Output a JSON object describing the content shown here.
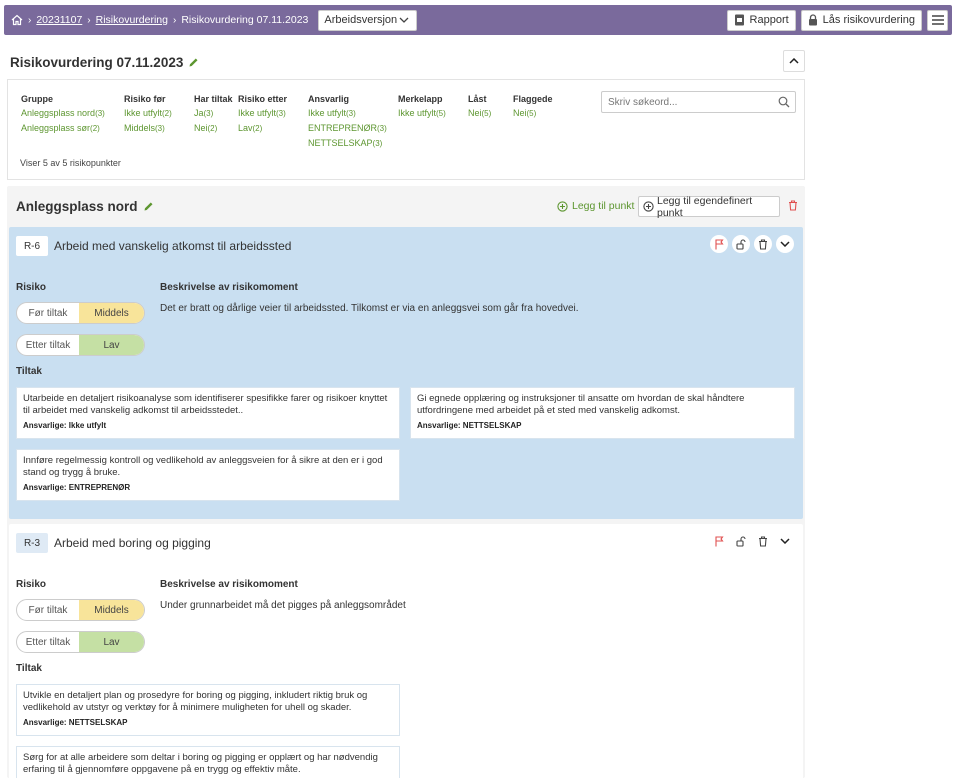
{
  "breadcrumb": {
    "project": "20231107",
    "section": "Risikovurdering",
    "current": "Risikovurdering 07.11.2023"
  },
  "version_select": {
    "value": "Arbeidsversjon"
  },
  "toolbar": {
    "report_label": "Rapport",
    "lock_label": "Lås risikovurdering"
  },
  "page": {
    "title": "Risikovurdering 07.11.2023"
  },
  "filters": {
    "columns": [
      {
        "header": "Gruppe",
        "items": [
          {
            "label": "Anleggsplass nord",
            "count": "(3)"
          },
          {
            "label": "Anleggsplass sør",
            "count": "(2)"
          }
        ]
      },
      {
        "header": "Risiko før",
        "items": [
          {
            "label": "Ikke utfylt",
            "count": "(2)"
          },
          {
            "label": "Middels",
            "count": "(3)"
          }
        ]
      },
      {
        "header": "Har tiltak",
        "items": [
          {
            "label": "Ja",
            "count": "(3)"
          },
          {
            "label": "Nei",
            "count": "(2)"
          }
        ]
      },
      {
        "header": "Risiko etter",
        "items": [
          {
            "label": "Ikke utfylt",
            "count": "(3)"
          },
          {
            "label": "Lav",
            "count": "(2)"
          }
        ]
      },
      {
        "header": "Ansvarlig",
        "items": [
          {
            "label": "Ikke utfylt",
            "count": "(3)"
          },
          {
            "label": "ENTREPRENØR",
            "count": "(3)"
          },
          {
            "label": "NETTSELSKAP",
            "count": "(3)"
          }
        ]
      },
      {
        "header": "Merkelapp",
        "items": [
          {
            "label": "Ikke utfylt",
            "count": "(5)"
          }
        ]
      },
      {
        "header": "Låst",
        "items": [
          {
            "label": "Nei",
            "count": "(5)"
          }
        ]
      },
      {
        "header": "Flaggede",
        "items": [
          {
            "label": "Nei",
            "count": "(5)"
          }
        ]
      }
    ],
    "search_placeholder": "Skriv søkeord...",
    "summary": "Viser 5 av 5 risikopunkter"
  },
  "group": {
    "title": "Anleggsplass nord",
    "add_point_label": "Legg til punkt",
    "add_custom_label": "Legg til egendefinert punkt"
  },
  "labels": {
    "risk": "Risiko",
    "description_heading": "Beskrivelse av risikomoment",
    "measures": "Tiltak",
    "before": "Før tiltak",
    "after": "Etter tiltak"
  },
  "cards": [
    {
      "id": "R-6",
      "title": "Arbeid med vanskelig atkomst til arbeidssted",
      "risk_before": "Middels",
      "risk_after": "Lav",
      "description": "Det er bratt og dårlige veier til arbeidssted. Tilkomst er via en anleggsvei som går fra hovedvei.",
      "measures": [
        {
          "text": "Utarbeide en detaljert risikoanalyse som identifiserer spesifikke farer og risikoer knyttet til arbeidet med vanskelig adkomst til arbeidsstedet..",
          "responsible": "Ansvarlige: Ikke utfylt"
        },
        {
          "text": "Gi egnede opplæring og instruksjoner til ansatte om hvordan de skal håndtere utfordringene med arbeidet på et sted med vanskelig adkomst.",
          "responsible": "Ansvarlige: NETTSELSKAP"
        },
        {
          "text": "Innføre regelmessig kontroll og vedlikehold av anleggsveien for å sikre at den er i god stand og trygg å bruke.",
          "responsible": "Ansvarlige: ENTREPRENØR"
        }
      ]
    },
    {
      "id": "R-3",
      "title": "Arbeid med boring og pigging",
      "risk_before": "Middels",
      "risk_after": "Lav",
      "description": "Under grunnarbeidet må det pigges på anleggsområdet",
      "measures": [
        {
          "text": "Utvikle en detaljert plan og prosedyre for boring og pigging, inkludert riktig bruk og vedlikehold av utstyr og verktøy for å minimere muligheten for uhell og skader.",
          "responsible": "Ansvarlige: NETTSELSKAP"
        },
        {
          "text": "Sørg for at alle arbeidere som deltar i boring og pigging er opplært og har nødvendig erfaring til å gjennomføre oppgavene på en trygg og effektiv måte.",
          "responsible": ""
        }
      ]
    }
  ],
  "colors": {
    "header_bar": "#7a6a9c",
    "accent_green": "#5d9630",
    "active_card": "#c9dff1",
    "risk_medium": "#f8e49a",
    "risk_low": "#c5e0a4",
    "flag_red": "#e05050"
  }
}
